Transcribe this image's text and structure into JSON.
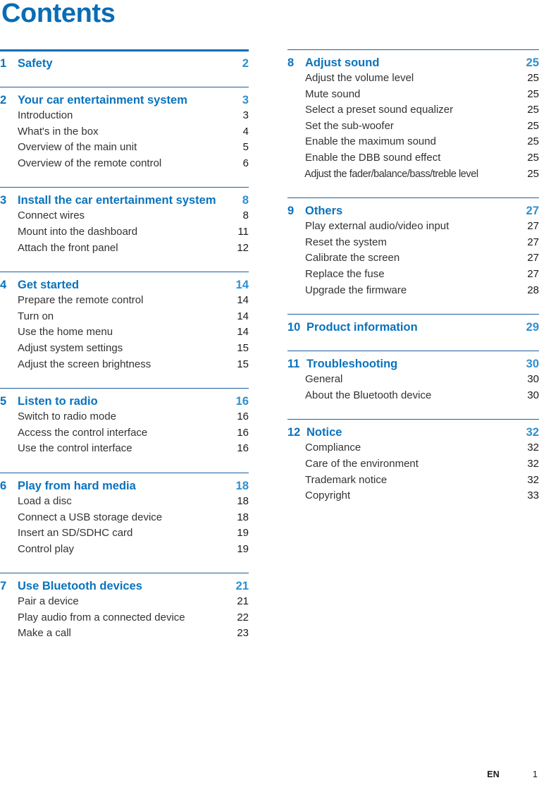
{
  "document": {
    "title": "Contents",
    "accent_blue": "#0a6cb4",
    "heading_blue": "#0a73bd",
    "page_number_blue": "#2e8fd0",
    "rule_blue": "#1c5f9e",
    "body_text_color": "#333333"
  },
  "footer": {
    "language": "EN",
    "page_number": "1"
  },
  "left_column": {
    "sections": [
      {
        "number": "1",
        "title": "Safety",
        "page": "2",
        "rule": "thick",
        "entries": []
      },
      {
        "number": "2",
        "title": "Your car entertainment system",
        "page": "3",
        "rule": "thin",
        "entries": [
          {
            "label": "Introduction",
            "page": "3"
          },
          {
            "label": "What's in the box",
            "page": "4"
          },
          {
            "label": "Overview of the main unit",
            "page": "5"
          },
          {
            "label": "Overview of the remote control",
            "page": "6"
          }
        ]
      },
      {
        "number": "3",
        "title": "Install the car entertainment system",
        "page": "8",
        "rule": "thin",
        "entries": [
          {
            "label": "Connect wires",
            "page": "8"
          },
          {
            "label": "Mount into the dashboard",
            "page": "11"
          },
          {
            "label": "Attach the front panel",
            "page": "12"
          }
        ]
      },
      {
        "number": "4",
        "title": "Get started",
        "page": "14",
        "rule": "thin",
        "entries": [
          {
            "label": "Prepare the remote control",
            "page": "14"
          },
          {
            "label": "Turn on",
            "page": "14"
          },
          {
            "label": "Use the home menu",
            "page": "14"
          },
          {
            "label": "Adjust system settings",
            "page": "15"
          },
          {
            "label": "Adjust the screen brightness",
            "page": "15"
          }
        ]
      },
      {
        "number": "5",
        "title": "Listen to radio",
        "page": "16",
        "rule": "thin",
        "entries": [
          {
            "label": "Switch to radio mode",
            "page": "16"
          },
          {
            "label": "Access the control interface",
            "page": "16"
          },
          {
            "label": "Use the control interface",
            "page": "16"
          }
        ]
      },
      {
        "number": "6",
        "title": "Play from hard media",
        "page": "18",
        "rule": "thin",
        "entries": [
          {
            "label": "Load a disc",
            "page": "18"
          },
          {
            "label": "Connect a USB storage device",
            "page": "18"
          },
          {
            "label": "Insert an SD/SDHC card",
            "page": "19"
          },
          {
            "label": "Control play",
            "page": "19"
          }
        ]
      },
      {
        "number": "7",
        "title": "Use Bluetooth devices",
        "page": "21",
        "rule": "thin",
        "entries": [
          {
            "label": "Pair a device",
            "page": "21"
          },
          {
            "label": "Play audio from a connected device",
            "page": "22"
          },
          {
            "label": "Make a call",
            "page": "23"
          }
        ]
      }
    ]
  },
  "right_column": {
    "sections": [
      {
        "number": "8",
        "title": "Adjust sound",
        "page": "25",
        "rule": "thin",
        "entries": [
          {
            "label": "Adjust the volume level",
            "page": "25"
          },
          {
            "label": "Mute sound",
            "page": "25"
          },
          {
            "label": "Select a preset sound equalizer",
            "page": "25"
          },
          {
            "label": "Set the sub-woofer",
            "page": "25"
          },
          {
            "label": "Enable the maximum sound",
            "page": "25"
          },
          {
            "label": "Enable the DBB sound effect",
            "page": "25"
          },
          {
            "label": "Adjust the fader/balance/bass/treble level",
            "page": "25",
            "condensed": true
          }
        ]
      },
      {
        "number": "9",
        "title": "Others",
        "page": "27",
        "rule": "thin",
        "entries": [
          {
            "label": "Play external audio/video input",
            "page": "27"
          },
          {
            "label": "Reset the system",
            "page": "27"
          },
          {
            "label": "Calibrate the screen",
            "page": "27"
          },
          {
            "label": "Replace the fuse",
            "page": "27"
          },
          {
            "label": "Upgrade the firmware",
            "page": "28"
          }
        ]
      },
      {
        "number": "10",
        "title": "Product information",
        "page": "29",
        "rule": "thin",
        "entries": []
      },
      {
        "number": "11",
        "title": "Troubleshooting",
        "page": "30",
        "rule": "thin",
        "entries": [
          {
            "label": "General",
            "page": "30"
          },
          {
            "label": "About the Bluetooth device",
            "page": "30"
          }
        ]
      },
      {
        "number": "12",
        "title": "Notice",
        "page": "32",
        "rule": "thin",
        "entries": [
          {
            "label": "Compliance",
            "page": "32"
          },
          {
            "label": "Care of the environment",
            "page": "32"
          },
          {
            "label": "Trademark notice",
            "page": "32"
          },
          {
            "label": "Copyright",
            "page": "33"
          }
        ]
      }
    ]
  }
}
